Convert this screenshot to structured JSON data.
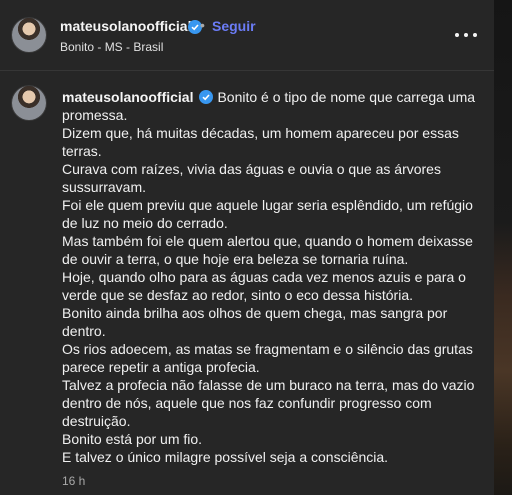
{
  "post": {
    "author": "mateusolanoofficial",
    "follow_label": "Seguir",
    "separator": "•",
    "location": "Bonito - MS - Brasil",
    "icons": {
      "verified": "verified-badge-icon",
      "more": "more-options-icon"
    },
    "colors": {
      "verified": "#3897f0",
      "follow": "#6b7cf6"
    }
  },
  "caption": {
    "author": "mateusolanoofficial",
    "lines": [
      "Bonito é o tipo de nome que carrega uma promessa.",
      "Dizem que, há muitas décadas, um homem apareceu por essas terras.",
      "Curava com raízes, vivia das águas e ouvia o que as árvores sussurravam.",
      "Foi ele quem previu que aquele lugar seria esplêndido, um refúgio de luz no meio do cerrado.",
      "Mas também foi ele quem alertou que, quando o homem deixasse de ouvir a terra, o que hoje era beleza se tornaria ruína.",
      "Hoje, quando olho para as águas cada vez menos azuis e para o verde que se desfaz ao redor, sinto o eco dessa história.",
      "Bonito ainda brilha aos olhos de quem chega, mas sangra por dentro.",
      "Os rios adoecem, as matas se fragmentam e o silêncio das grutas parece repetir a antiga profecia.",
      "Talvez a profecia não falasse de um buraco na terra, mas do vazio dentro de nós, aquele que nos faz confundir progresso com destruição.",
      "Bonito está por um fio.",
      "E talvez o único milagre possível seja a consciência."
    ],
    "timestamp": "16 h"
  }
}
